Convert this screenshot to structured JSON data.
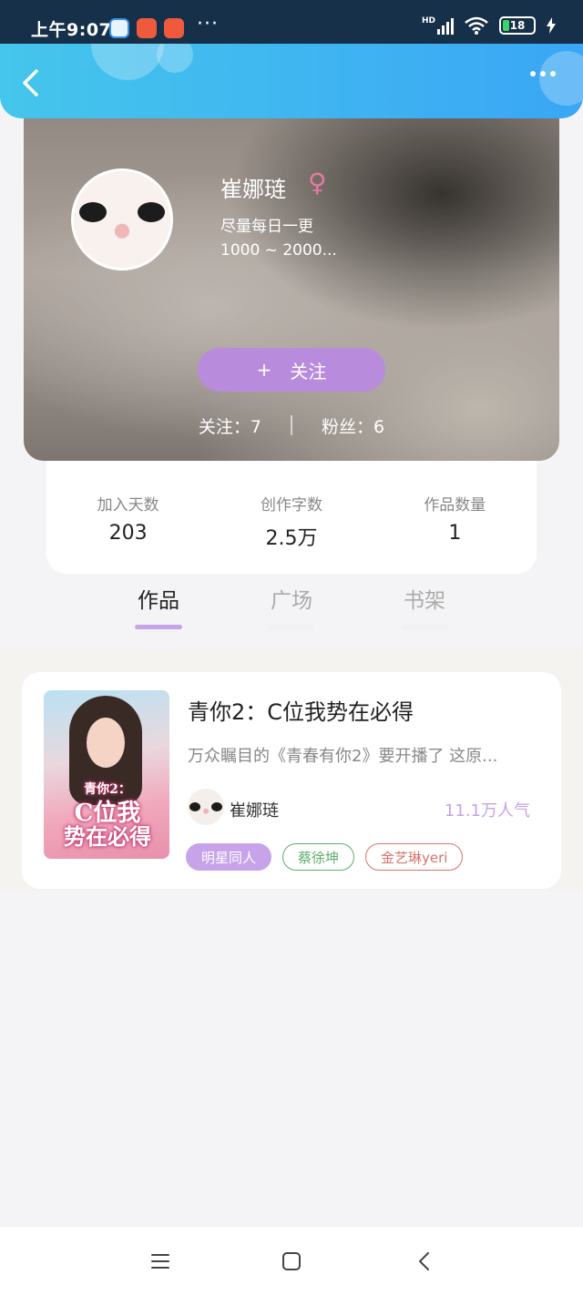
{
  "status_bar": {
    "time": "上午9:07",
    "network": "HD",
    "battery": "18"
  },
  "profile": {
    "name": "崔娜琏",
    "gender_symbol": "♀",
    "bio_line1": "尽量每日一更",
    "bio_line2": "1000 ~ 2000...",
    "follow_button": "关注",
    "follow_plus": "+",
    "following": "关注：7",
    "followers": "粉丝：6"
  },
  "stats": [
    {
      "label": "加入天数",
      "value": "203"
    },
    {
      "label": "创作字数",
      "value": "2.5万"
    },
    {
      "label": "作品数量",
      "value": "1"
    }
  ],
  "tabs": [
    {
      "label": "作品",
      "active": true
    },
    {
      "label": "广场",
      "active": false
    },
    {
      "label": "书架",
      "active": false
    }
  ],
  "book": {
    "title": "青你2：C位我势在必得",
    "description": "万众瞩目的《青春有你2》要开播了 这原...",
    "author": "崔娜琏",
    "popularity": "11.1万人气",
    "cover_text": {
      "line1": "青你2：",
      "line2": "C位我",
      "line3": "势在必得"
    },
    "tags": [
      "明星同人",
      "蔡徐坤",
      "金艺琳yeri"
    ]
  },
  "colors": {
    "accent": "#c7a4ea",
    "header": "#3aa6f5",
    "follow_button": "#b88bdd"
  }
}
